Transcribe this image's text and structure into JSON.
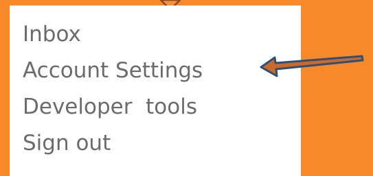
{
  "colors": {
    "background": "#f7892a",
    "panel": "#ffffff",
    "item_text": "#6b6b6b",
    "arrow_fill": "#c86a2a",
    "arrow_outline": "#2e4f7a"
  },
  "menu": {
    "items": [
      {
        "label": "Inbox"
      },
      {
        "label": "Account Settings"
      },
      {
        "label": "Developer  tools"
      },
      {
        "label": "Sign out"
      }
    ]
  },
  "icons": {
    "caret": "dropdown-caret-icon",
    "pointer": "pointer-arrow-icon"
  }
}
